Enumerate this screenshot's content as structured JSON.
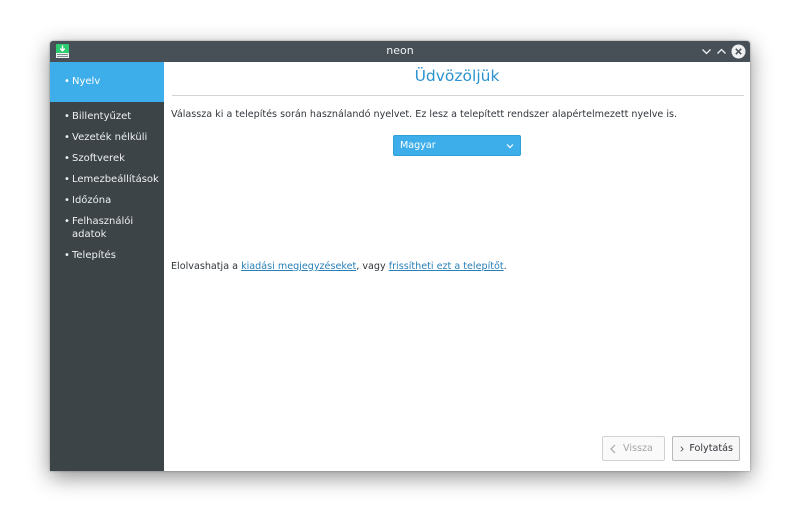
{
  "window": {
    "title": "neon"
  },
  "sidebar": {
    "items": [
      {
        "label": "Nyelv",
        "active": true
      },
      {
        "label": "Billentyűzet",
        "active": false
      },
      {
        "label": "Vezeték nélküli",
        "active": false
      },
      {
        "label": "Szoftverek",
        "active": false
      },
      {
        "label": "Lemezbeállítások",
        "active": false
      },
      {
        "label": "Időzóna",
        "active": false
      },
      {
        "label": "Felhasználói",
        "label2": "adatok",
        "active": false
      },
      {
        "label": "Telepítés",
        "active": false
      }
    ],
    "bullet": "•"
  },
  "main": {
    "title": "Üdvözöljük",
    "intro": "Válassza ki a telepítés során használandó nyelvet. Ez lesz a telepített rendszer alapértelmezett nyelve is.",
    "language_select": {
      "value": "Magyar"
    },
    "release": {
      "prefix": "Elolvashatja a ",
      "link1": "kiadási megjegyzéseket",
      "middle": ", vagy ",
      "link2": "frissítheti ezt a telepítőt",
      "suffix": "."
    },
    "buttons": {
      "back": "Vissza",
      "next": "Folytatás"
    }
  },
  "colors": {
    "accent": "#3daee9",
    "sidebar_bg": "#3c4447",
    "titlebar_bg": "#475057",
    "title_text": "#2c93d0",
    "link": "#2980b9"
  }
}
